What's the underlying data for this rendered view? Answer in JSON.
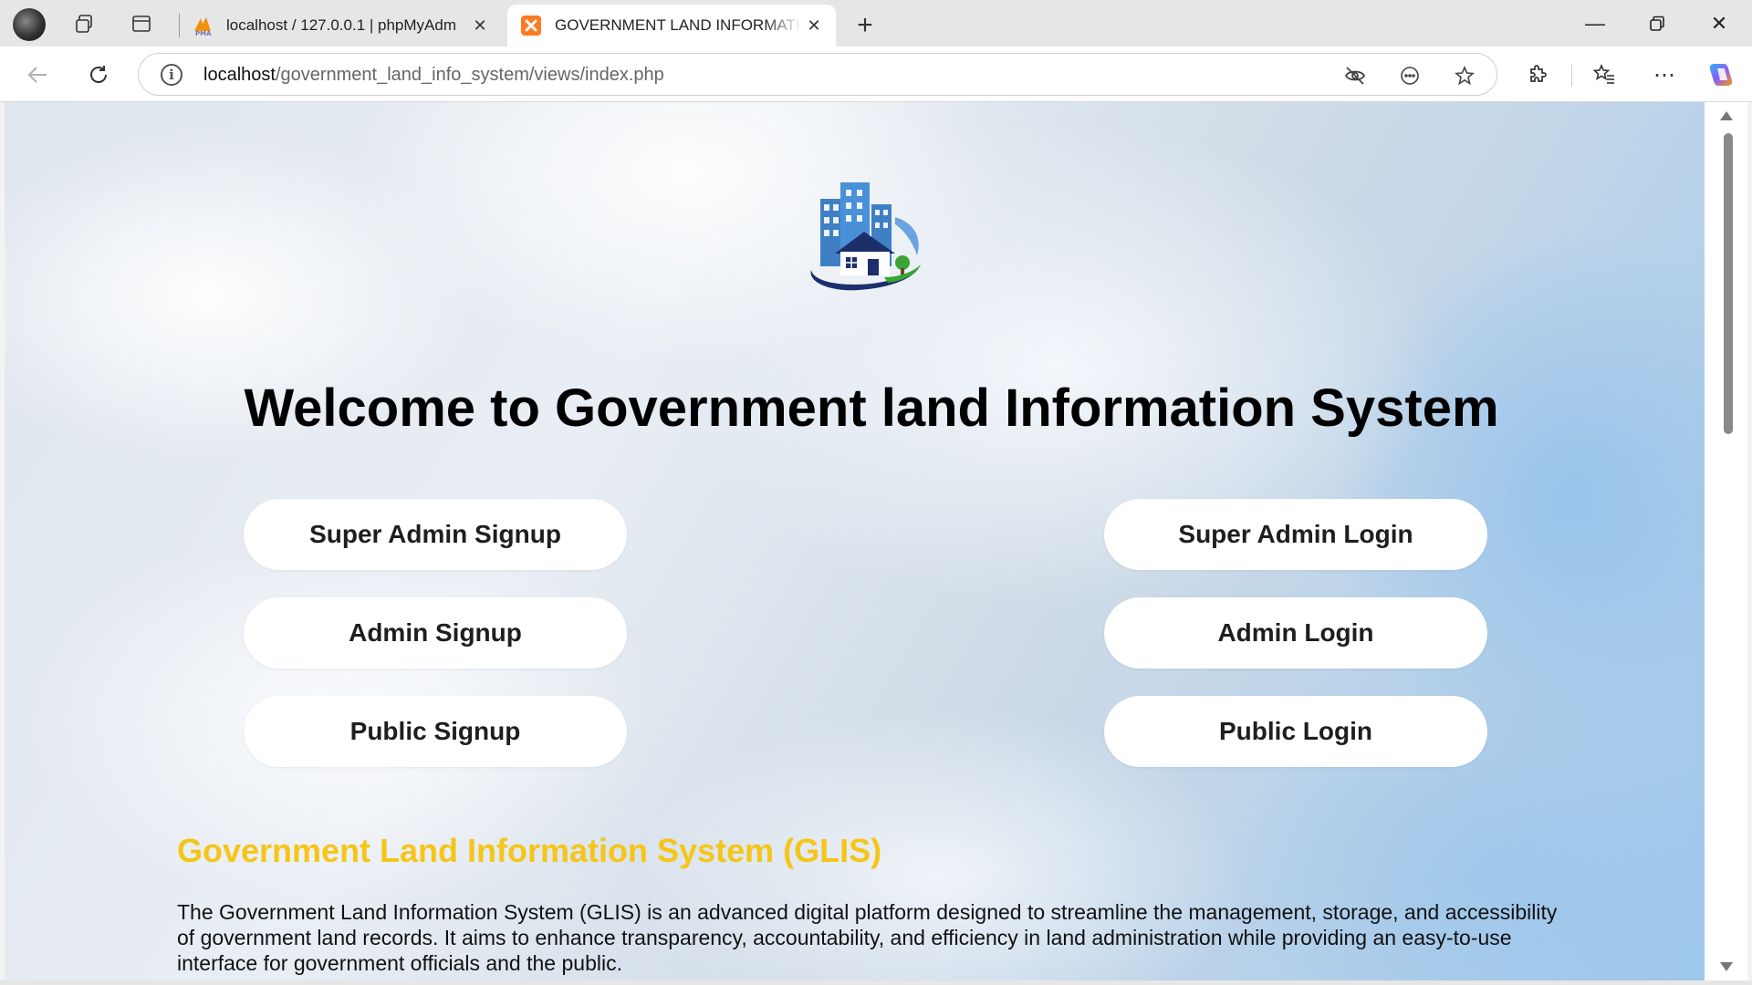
{
  "browser": {
    "tabs": [
      {
        "title": "localhost / 127.0.0.1 | phpMyAdm",
        "favicon": "phpmyadmin-icon",
        "active": false
      },
      {
        "title": "GOVERNMENT LAND INFORMATI",
        "favicon": "xampp-icon",
        "active": true
      }
    ],
    "address": {
      "host": "localhost",
      "path": "/government_land_info_system/views/index.php"
    },
    "icons": [
      "back-icon",
      "refresh-icon",
      "info-icon",
      "tracking-prevention-icon",
      "read-aloud-icon",
      "favorite-star-icon",
      "extensions-icon",
      "favorites-icon",
      "more-icon",
      "copilot-icon"
    ]
  },
  "page": {
    "welcome_title": "Welcome to Government land Information System",
    "buttons": {
      "super_admin_signup": "Super Admin Signup",
      "super_admin_login": "Super Admin Login",
      "admin_signup": "Admin Signup",
      "admin_login": "Admin Login",
      "public_signup": "Public Signup",
      "public_login": "Public Login"
    },
    "section_heading": "Government Land Information System (GLIS)",
    "description": "The Government Land Information System (GLIS) is an advanced digital platform designed to streamline the management, storage, and accessibility of government land records. It aims to enhance transparency, accountability, and efficiency in land administration while providing an easy-to-use interface for government officials and the public."
  },
  "colors": {
    "heading_accent": "#f5c518",
    "logo_blue": "#3f7fc4",
    "logo_navy": "#1d2f6b",
    "logo_green": "#3aa435"
  }
}
